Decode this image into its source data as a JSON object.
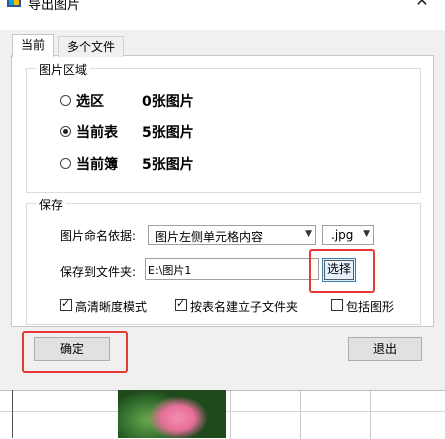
{
  "window": {
    "title": "导出图片"
  },
  "tabs": [
    {
      "label": "当前",
      "active": true
    },
    {
      "label": "多个文件",
      "active": false
    }
  ],
  "area_group": {
    "title": "图片区域",
    "options": [
      {
        "label": "选区",
        "count": "0张图片",
        "checked": false
      },
      {
        "label": "当前表",
        "count": "5张图片",
        "checked": true
      },
      {
        "label": "当前簿",
        "count": "5张图片",
        "checked": false
      }
    ]
  },
  "save_group": {
    "title": "保存",
    "naming_label": "图片命名依据:",
    "naming_value": "图片左侧单元格内容",
    "extension_value": ".jpg",
    "folder_label": "保存到文件夹:",
    "folder_value": "E:\\图片1",
    "choose_label": "选择"
  },
  "options": [
    {
      "label": "高清晰度模式",
      "checked": true
    },
    {
      "label": "按表名建立子文件夹",
      "checked": true
    },
    {
      "label": "包括图形",
      "checked": false
    }
  ],
  "buttons": {
    "ok": "确定",
    "exit": "退出"
  },
  "colors": {
    "highlight": "#e53935",
    "dialog_bg": "#f0f0f0",
    "button_face": "#e1e1e1"
  }
}
